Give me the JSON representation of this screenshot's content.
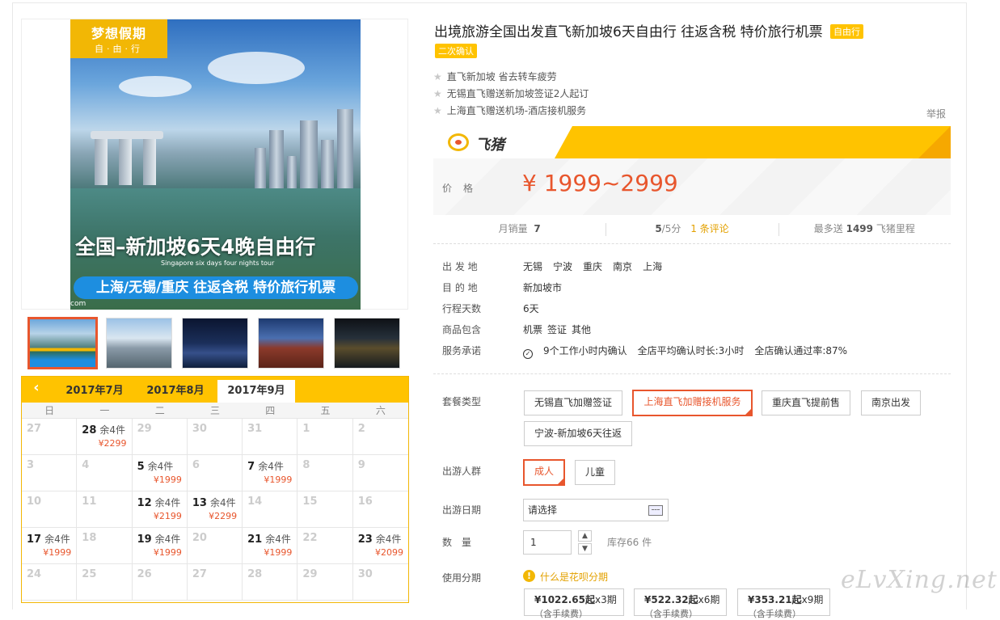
{
  "poster": {
    "badge_title": "梦想假期",
    "badge_sub": "自·由·行",
    "headline": "全国–新加坡6天4晚自由行",
    "headline_en": "Singapore six days four nights tour",
    "band": "上海/无锡/重庆 往返含税 特价旅行机票",
    "corner": "com"
  },
  "product": {
    "title": "出境旅游全国出发直飞新加坡6天自由行 往返含税 特价旅行机票",
    "tag_free": "自由行",
    "tag_confirm": "二次确认",
    "features": [
      "直飞新加坡 省去转车疲劳",
      "无锡直飞赠送新加坡签证2人起订",
      "上海直飞赠送机场-酒店接机服务"
    ],
    "report": "举报"
  },
  "brand": {
    "name": "飞猪"
  },
  "price": {
    "label": "价格",
    "value": "¥ 1999~2999"
  },
  "stats": {
    "monthly_label": "月销量",
    "monthly_value": "7",
    "rating_value": "5",
    "rating_suffix": "/5分",
    "reviews_count": "1",
    "reviews_label": "条评论",
    "points_prefix": "最多送",
    "points_value": "1499",
    "points_suffix": "飞猪里程"
  },
  "info": {
    "departure_label": "出 发 地",
    "departure": [
      "无锡",
      "宁波",
      "重庆",
      "南京",
      "上海"
    ],
    "destination_label": "目 的 地",
    "destination": "新加坡市",
    "days_label": "行程天数",
    "days": "6天",
    "includes_label": "商品包含",
    "includes": [
      "机票",
      "签证",
      "其他"
    ],
    "service_label": "服务承诺",
    "service": [
      "9个工作小时内确认",
      "全店平均确认时长:3小时",
      "全店确认通过率:87%"
    ]
  },
  "options": {
    "package_label": "套餐类型",
    "packages": [
      "无锡直飞加赠签证",
      "上海直飞加赠接机服务",
      "重庆直飞提前售",
      "南京出发",
      "宁波-新加坡6天往返"
    ],
    "crowd_label": "出游人群",
    "crowd": [
      "成人",
      "儿童"
    ],
    "date_label": "出游日期",
    "date_placeholder": "请选择",
    "qty_label": "数　量",
    "qty_value": "1",
    "stock": "库存66 件",
    "installment_label": "使用分期",
    "installment_link": "什么是花呗分期",
    "installments": [
      {
        "amount": "¥1022.65起",
        "periods": "x3期",
        "sub": "（含手续费）"
      },
      {
        "amount": "¥522.32起",
        "periods": "x6期",
        "sub": "（含手续费）"
      },
      {
        "amount": "¥353.21起",
        "periods": "x9期",
        "sub": "（含手续费）"
      }
    ]
  },
  "calendar": {
    "months": [
      "2017年7月",
      "2017年8月",
      "2017年9月"
    ],
    "weekdays": [
      "日",
      "一",
      "二",
      "三",
      "四",
      "五",
      "六"
    ],
    "days": [
      {
        "d": "27"
      },
      {
        "d": "28",
        "rem": "余4件",
        "price": "¥2299"
      },
      {
        "d": "29"
      },
      {
        "d": "30"
      },
      {
        "d": "31"
      },
      {
        "d": "1"
      },
      {
        "d": "2"
      },
      {
        "d": "3"
      },
      {
        "d": "4"
      },
      {
        "d": "5",
        "rem": "余4件",
        "price": "¥1999"
      },
      {
        "d": "6"
      },
      {
        "d": "7",
        "rem": "余4件",
        "price": "¥1999"
      },
      {
        "d": "8"
      },
      {
        "d": "9"
      },
      {
        "d": "10"
      },
      {
        "d": "11"
      },
      {
        "d": "12",
        "rem": "余4件",
        "price": "¥2199"
      },
      {
        "d": "13",
        "rem": "余4件",
        "price": "¥2299"
      },
      {
        "d": "14"
      },
      {
        "d": "15"
      },
      {
        "d": "16"
      },
      {
        "d": "17",
        "rem": "余4件",
        "price": "¥1999"
      },
      {
        "d": "18"
      },
      {
        "d": "19",
        "rem": "余4件",
        "price": "¥1999"
      },
      {
        "d": "20"
      },
      {
        "d": "21",
        "rem": "余4件",
        "price": "¥1999"
      },
      {
        "d": "22"
      },
      {
        "d": "23",
        "rem": "余4件",
        "price": "¥2099"
      },
      {
        "d": "24"
      },
      {
        "d": "25"
      },
      {
        "d": "26"
      },
      {
        "d": "27"
      },
      {
        "d": "28"
      },
      {
        "d": "29"
      },
      {
        "d": "30"
      }
    ]
  },
  "watermark": "eLvXing.net",
  "colors": {
    "accent": "#ffc300",
    "price": "#e8562d",
    "link": "#e3a100"
  }
}
